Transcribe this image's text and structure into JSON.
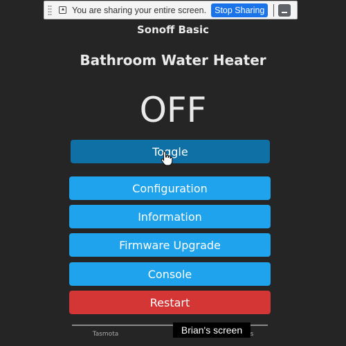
{
  "share_bar": {
    "message": "You are sharing your entire screen.",
    "stop_label": "Stop Sharing"
  },
  "header": {
    "device": "Sonoff Basic",
    "friendly_name": "Bathroom Water Heater"
  },
  "power": {
    "state": "OFF"
  },
  "buttons": {
    "toggle": "Toggle",
    "configuration": "Configuration",
    "information": "Information",
    "firmware_upgrade": "Firmware Upgrade",
    "console": "Console",
    "restart": "Restart"
  },
  "footer": {
    "left": "Tasmota",
    "right": "Arends"
  },
  "overlay": {
    "label": "Brian's screen"
  },
  "colors": {
    "background": "#252525",
    "button": "#1fa3ec",
    "button_active": "#0e70a4",
    "restart": "#d43535",
    "share_stop": "#1a73e8"
  }
}
